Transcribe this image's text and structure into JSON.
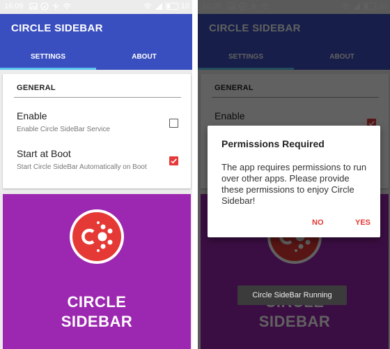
{
  "status": {
    "time": "16:09",
    "battery": "10"
  },
  "app": {
    "title": "CIRCLE SIDEBAR"
  },
  "tabs": [
    {
      "label": "SETTINGS"
    },
    {
      "label": "ABOUT"
    }
  ],
  "settings": {
    "section": "GENERAL",
    "enable": {
      "label": "Enable",
      "sub": "Enable Circle SideBar Service",
      "checked": false
    },
    "boot": {
      "label": "Start at Boot",
      "sub": "Start Circle SideBar Automatically on Boot",
      "checked": true
    }
  },
  "hero": {
    "line1": "CIRCLE",
    "line2": "SIDEBAR"
  },
  "dialog": {
    "title": "Permissions Required",
    "body": "The app requires permissions to run over other apps. Please provide these permissions to enjoy Circle Sidebar!",
    "no": "NO",
    "yes": "YES"
  },
  "toast": "Circle SideBar Running",
  "colors": {
    "primary": "#3a4fbf",
    "accent": "#e53935",
    "hero": "#9c27b0",
    "tab_indicator": "#5bc4f0"
  }
}
